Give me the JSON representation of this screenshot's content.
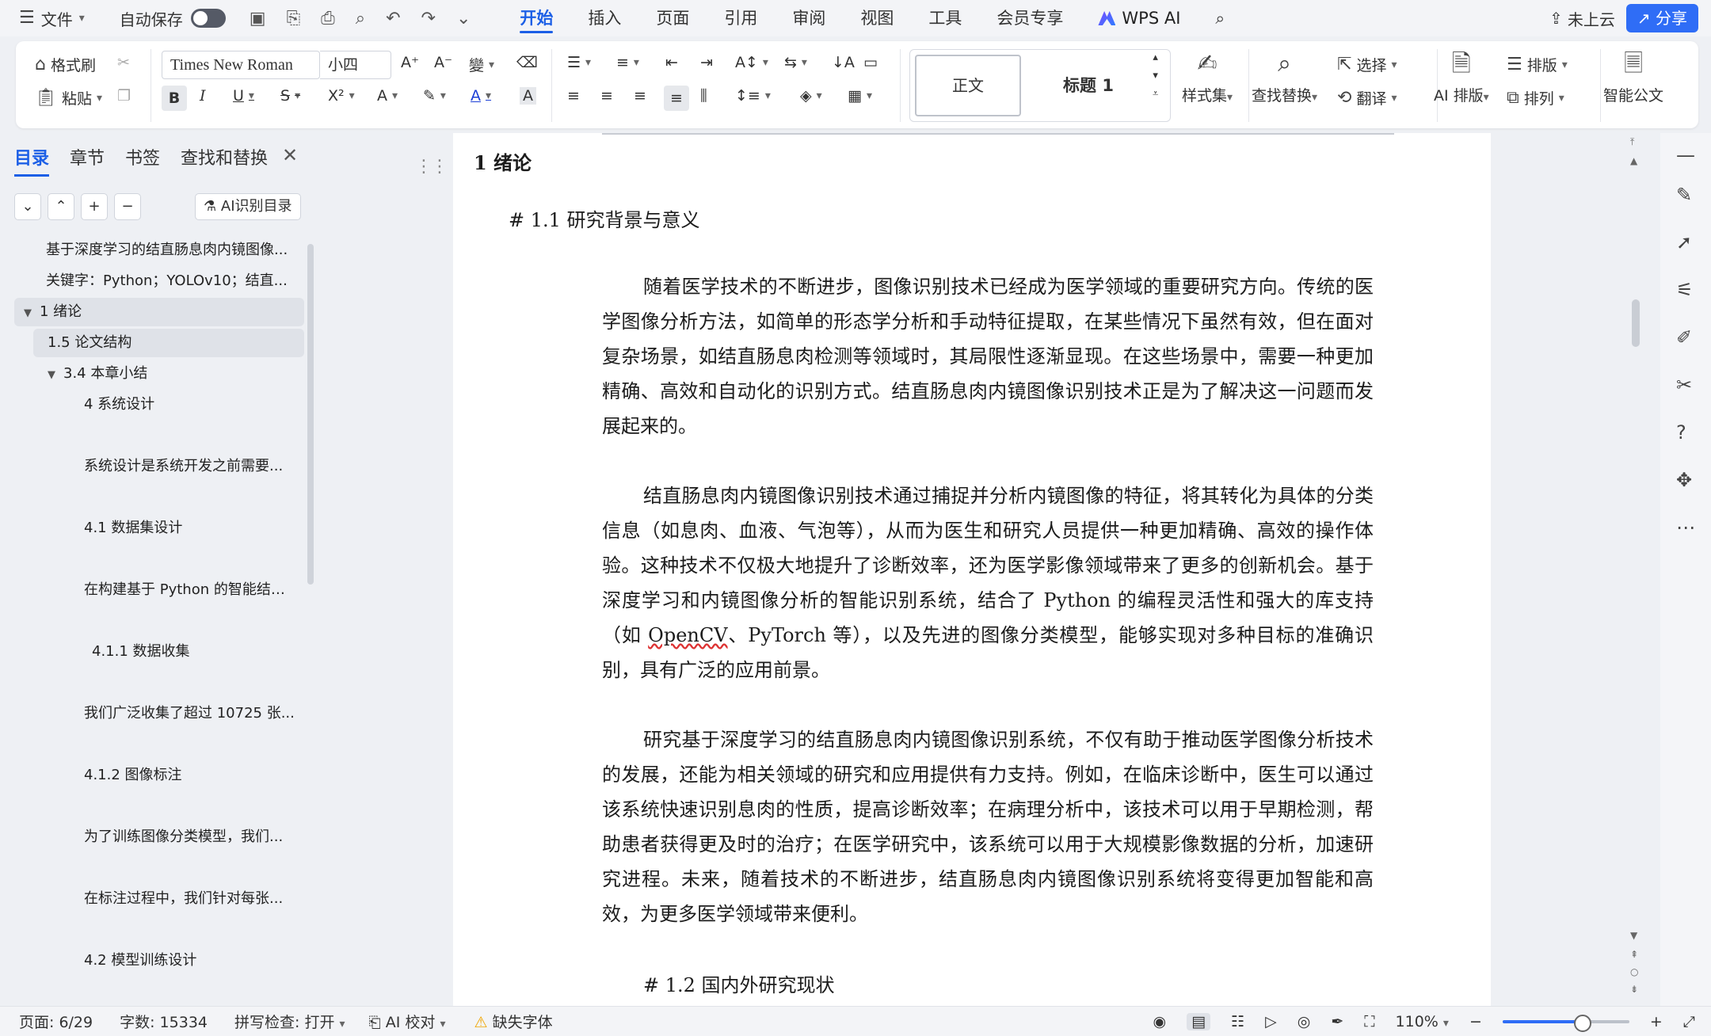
{
  "menubar": {
    "file": "文件",
    "autosave": "自动保存",
    "tabs": [
      "开始",
      "插入",
      "页面",
      "引用",
      "审阅",
      "视图",
      "工具",
      "会员专享",
      "WPS AI"
    ],
    "active_tab": "开始",
    "cloud": "未上云",
    "share": "分享"
  },
  "ribbon": {
    "format_painter": "格式刷",
    "paste": "粘贴",
    "font_name": "Times New Roman",
    "font_size": "小四",
    "style_normal": "正文",
    "style_heading": "标题 1",
    "style_set": "样式集",
    "find_replace": "查找替换",
    "select": "选择",
    "translate": "翻译",
    "ai_layout": "AI 排版",
    "layout": "排版",
    "arrange": "排列",
    "smart_doc": "智能公文"
  },
  "panel": {
    "tabs": [
      "目录",
      "章节",
      "书签",
      "查找和替换"
    ],
    "active_tab": "目录",
    "ai_toc": "AI识别目录",
    "toc": [
      {
        "label": "基于深度学习的结直肠息肉内镜图像...",
        "level": 0,
        "selected": false
      },
      {
        "label": "关键字：Python；YOLOv10；结直...",
        "level": 0,
        "selected": false
      },
      {
        "label": "1 绪论",
        "level": 0,
        "selected": true,
        "arrow": true
      },
      {
        "label": "1.5 论文结构",
        "level": 1,
        "selected": true
      },
      {
        "label": "3.4 本章小结",
        "level": 1,
        "selected": false,
        "arrow": true
      },
      {
        "label": "4 系统设计",
        "level": 2,
        "selected": false
      },
      {
        "label": "系统设计是系统开发之前需要...",
        "level": 2,
        "selected": false
      },
      {
        "label": "4.1 数据集设计",
        "level": 2,
        "selected": false
      },
      {
        "label": "在构建基于 Python 的智能结直...",
        "level": 2,
        "selected": false
      },
      {
        "label": "4.1.1 数据收集",
        "level": 3,
        "selected": false
      },
      {
        "label": "我们广泛收集了超过 10725 张...",
        "level": 2,
        "selected": false
      },
      {
        "label": "4.1.2 图像标注",
        "level": 2,
        "selected": false
      },
      {
        "label": "为了训练图像分类模型，我们...",
        "level": 2,
        "selected": false
      },
      {
        "label": "在标注过程中，我们针对每张...",
        "level": 2,
        "selected": false
      },
      {
        "label": "4.2 模型训练设计",
        "level": 2,
        "selected": false
      }
    ]
  },
  "doc": {
    "h1": "1  绪论",
    "h2a": "# 1.1  研究背景与意义",
    "p1": "随着医学技术的不断进步，图像识别技术已经成为医学领域的重要研究方向。传统的医学图像分析方法，如简单的形态学分析和手动特征提取，在某些情况下虽然有效，但在面对复杂场景，如结直肠息肉检测等领域时，其局限性逐渐显现。在这些场景中，需要一种更加精确、高效和自动化的识别方式。结直肠息肉内镜图像识别技术正是为了解决这一问题而发展起来的。",
    "p2a": "结直肠息肉内镜图像识别技术通过捕捉并分析内镜图像的特征，将其转化为具体的分类信息（如息肉、血液、气泡等），从而为医生和研究人员提供一种更加精确、高效的操作体验。这种技术不仅极大地提升了诊断效率，还为医学影像领域带来了更多的创新机会。基于深度学习和内镜图像分析的智能识别系统，结合了 Python 的编程灵活性和强大的库支持（如 ",
    "p2_opencv": "OpenCV",
    "p2b": "、PyTorch 等），以及先进的图像分类模型，能够实现对多种目标的准确识别，具有广泛的应用前景。",
    "p3": "研究基于深度学习的结直肠息肉内镜图像识别系统，不仅有助于推动医学图像分析技术的发展，还能为相关领域的研究和应用提供有力支持。例如，在临床诊断中，医生可以通过该系统快速识别息肉的性质，提高诊断效率；在病理分析中，该技术可以用于早期检测，帮助患者获得更及时的治疗；在医学研究中，该系统可以用于大规模影像数据的分析，加速研究进程。未来，随着技术的不断进步，结直肠息肉内镜图像识别系统将变得更加智能和高效，为更多医学领域带来便利。",
    "h2b": "# 1.2  国内外研究现状"
  },
  "status": {
    "page": "页面: 6/29",
    "words": "字数: 15334",
    "spell": "拼写检查: 打开",
    "ai_check": "AI 校对",
    "missing_font": "缺失字体",
    "zoom": "110%"
  },
  "colors": {
    "accent": "#1c5fe6",
    "share_bg": "#2f6df6",
    "warn": "#f0a500"
  }
}
